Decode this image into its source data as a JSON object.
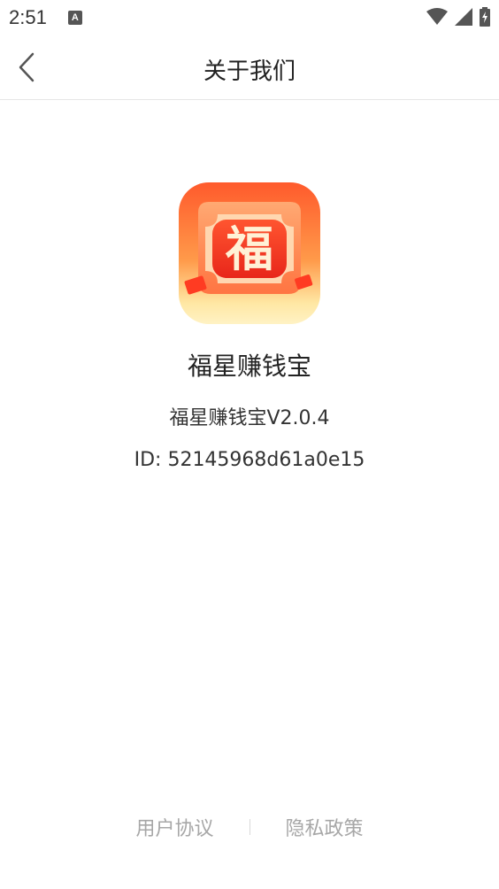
{
  "status_bar": {
    "time": "2:51",
    "notification_icon": "A",
    "icons": [
      "wifi-icon",
      "signal-icon",
      "battery-charging-icon"
    ]
  },
  "header": {
    "back_icon": "chevron-left-icon",
    "title": "关于我们"
  },
  "app": {
    "logo_glyph": "福",
    "name": "福星赚钱宝",
    "version": "福星赚钱宝V2.0.4",
    "id": "ID: 52145968d61a0e15"
  },
  "footer": {
    "user_agreement": "用户协议",
    "privacy_policy": "隐私政策"
  },
  "colors": {
    "logo_red": "#f23a1e",
    "logo_orange": "#ff8a3d",
    "logo_yellow": "#ffe7a3",
    "link_gray": "#a7a7a7"
  }
}
